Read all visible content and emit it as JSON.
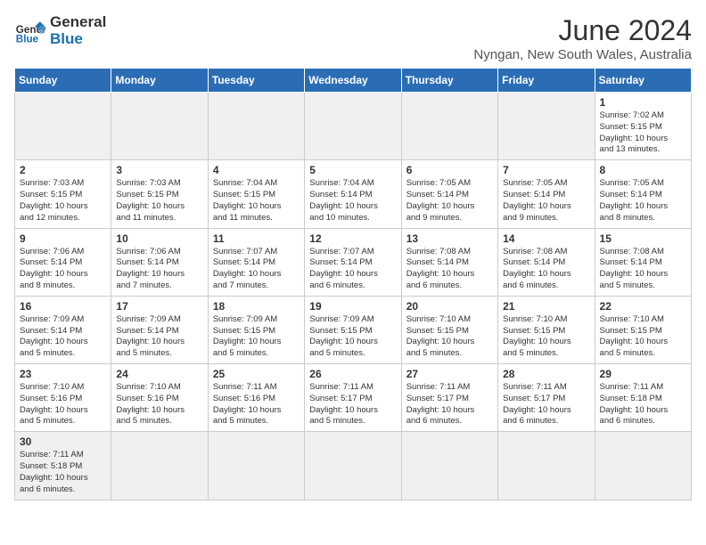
{
  "header": {
    "logo_general": "General",
    "logo_blue": "Blue",
    "month_title": "June 2024",
    "location": "Nyngan, New South Wales, Australia"
  },
  "days_of_week": [
    "Sunday",
    "Monday",
    "Tuesday",
    "Wednesday",
    "Thursday",
    "Friday",
    "Saturday"
  ],
  "weeks": [
    [
      {
        "day": "",
        "info": ""
      },
      {
        "day": "",
        "info": ""
      },
      {
        "day": "",
        "info": ""
      },
      {
        "day": "",
        "info": ""
      },
      {
        "day": "",
        "info": ""
      },
      {
        "day": "",
        "info": ""
      },
      {
        "day": "1",
        "info": "Sunrise: 7:02 AM\nSunset: 5:15 PM\nDaylight: 10 hours\nand 13 minutes."
      }
    ],
    [
      {
        "day": "2",
        "info": "Sunrise: 7:03 AM\nSunset: 5:15 PM\nDaylight: 10 hours\nand 12 minutes."
      },
      {
        "day": "3",
        "info": "Sunrise: 7:03 AM\nSunset: 5:15 PM\nDaylight: 10 hours\nand 11 minutes."
      },
      {
        "day": "4",
        "info": "Sunrise: 7:04 AM\nSunset: 5:15 PM\nDaylight: 10 hours\nand 11 minutes."
      },
      {
        "day": "5",
        "info": "Sunrise: 7:04 AM\nSunset: 5:14 PM\nDaylight: 10 hours\nand 10 minutes."
      },
      {
        "day": "6",
        "info": "Sunrise: 7:05 AM\nSunset: 5:14 PM\nDaylight: 10 hours\nand 9 minutes."
      },
      {
        "day": "7",
        "info": "Sunrise: 7:05 AM\nSunset: 5:14 PM\nDaylight: 10 hours\nand 9 minutes."
      },
      {
        "day": "8",
        "info": "Sunrise: 7:05 AM\nSunset: 5:14 PM\nDaylight: 10 hours\nand 8 minutes."
      }
    ],
    [
      {
        "day": "9",
        "info": "Sunrise: 7:06 AM\nSunset: 5:14 PM\nDaylight: 10 hours\nand 8 minutes."
      },
      {
        "day": "10",
        "info": "Sunrise: 7:06 AM\nSunset: 5:14 PM\nDaylight: 10 hours\nand 7 minutes."
      },
      {
        "day": "11",
        "info": "Sunrise: 7:07 AM\nSunset: 5:14 PM\nDaylight: 10 hours\nand 7 minutes."
      },
      {
        "day": "12",
        "info": "Sunrise: 7:07 AM\nSunset: 5:14 PM\nDaylight: 10 hours\nand 6 minutes."
      },
      {
        "day": "13",
        "info": "Sunrise: 7:08 AM\nSunset: 5:14 PM\nDaylight: 10 hours\nand 6 minutes."
      },
      {
        "day": "14",
        "info": "Sunrise: 7:08 AM\nSunset: 5:14 PM\nDaylight: 10 hours\nand 6 minutes."
      },
      {
        "day": "15",
        "info": "Sunrise: 7:08 AM\nSunset: 5:14 PM\nDaylight: 10 hours\nand 5 minutes."
      }
    ],
    [
      {
        "day": "16",
        "info": "Sunrise: 7:09 AM\nSunset: 5:14 PM\nDaylight: 10 hours\nand 5 minutes."
      },
      {
        "day": "17",
        "info": "Sunrise: 7:09 AM\nSunset: 5:14 PM\nDaylight: 10 hours\nand 5 minutes."
      },
      {
        "day": "18",
        "info": "Sunrise: 7:09 AM\nSunset: 5:15 PM\nDaylight: 10 hours\nand 5 minutes."
      },
      {
        "day": "19",
        "info": "Sunrise: 7:09 AM\nSunset: 5:15 PM\nDaylight: 10 hours\nand 5 minutes."
      },
      {
        "day": "20",
        "info": "Sunrise: 7:10 AM\nSunset: 5:15 PM\nDaylight: 10 hours\nand 5 minutes."
      },
      {
        "day": "21",
        "info": "Sunrise: 7:10 AM\nSunset: 5:15 PM\nDaylight: 10 hours\nand 5 minutes."
      },
      {
        "day": "22",
        "info": "Sunrise: 7:10 AM\nSunset: 5:15 PM\nDaylight: 10 hours\nand 5 minutes."
      }
    ],
    [
      {
        "day": "23",
        "info": "Sunrise: 7:10 AM\nSunset: 5:16 PM\nDaylight: 10 hours\nand 5 minutes."
      },
      {
        "day": "24",
        "info": "Sunrise: 7:10 AM\nSunset: 5:16 PM\nDaylight: 10 hours\nand 5 minutes."
      },
      {
        "day": "25",
        "info": "Sunrise: 7:11 AM\nSunset: 5:16 PM\nDaylight: 10 hours\nand 5 minutes."
      },
      {
        "day": "26",
        "info": "Sunrise: 7:11 AM\nSunset: 5:17 PM\nDaylight: 10 hours\nand 5 minutes."
      },
      {
        "day": "27",
        "info": "Sunrise: 7:11 AM\nSunset: 5:17 PM\nDaylight: 10 hours\nand 6 minutes."
      },
      {
        "day": "28",
        "info": "Sunrise: 7:11 AM\nSunset: 5:17 PM\nDaylight: 10 hours\nand 6 minutes."
      },
      {
        "day": "29",
        "info": "Sunrise: 7:11 AM\nSunset: 5:18 PM\nDaylight: 10 hours\nand 6 minutes."
      }
    ],
    [
      {
        "day": "30",
        "info": "Sunrise: 7:11 AM\nSunset: 5:18 PM\nDaylight: 10 hours\nand 6 minutes."
      },
      {
        "day": "",
        "info": ""
      },
      {
        "day": "",
        "info": ""
      },
      {
        "day": "",
        "info": ""
      },
      {
        "day": "",
        "info": ""
      },
      {
        "day": "",
        "info": ""
      },
      {
        "day": "",
        "info": ""
      }
    ]
  ]
}
